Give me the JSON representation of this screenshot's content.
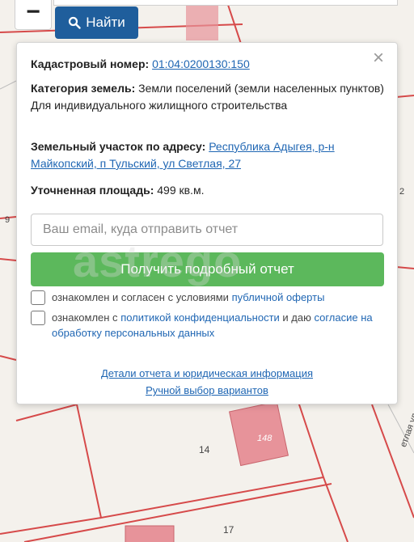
{
  "toolbar": {
    "zoom_out_label": "−",
    "search_label": "Найти"
  },
  "map": {
    "labels": [
      "9",
      "2",
      "14",
      "17",
      "148",
      "етлая ул."
    ]
  },
  "popup": {
    "cadastral_label": "Кадастровый номер:",
    "cadastral_value": "01:04:0200130:150",
    "category_label": "Категория земель:",
    "category_value": "Земли поселений (земли населенных пунктов)",
    "usage": "Для индивидуального жилищного строительства",
    "address_label": "Земельный участок по адресу:",
    "address_value": "Республика Адыгея, р-н Майкопский, п Тульский, ул Светлая, 27",
    "area_label": "Уточненная площадь:",
    "area_value": "499 кв.м.",
    "email_placeholder": "Ваш email, куда отправить отчет",
    "cta_label": "Получить подробный отчет",
    "consent1_prefix": "ознакомлен и согласен с условиями ",
    "consent1_link": "публичной оферты",
    "consent2_prefix": "ознакомлен с ",
    "consent2_link1": "политикой конфиденциальности",
    "consent2_mid": " и даю ",
    "consent2_link2": "согласие на обработку персональных данных",
    "details_link": "Детали отчета и юридическая информация",
    "manual_link": "Ручной выбор вариантов",
    "close_label": "×"
  },
  "watermark": "astrego",
  "colors": {
    "accent": "#1f5e9c",
    "cta": "#5cb85c",
    "link": "#1f66b3",
    "parcel_line": "#d64040",
    "building": "#e08a8f"
  }
}
